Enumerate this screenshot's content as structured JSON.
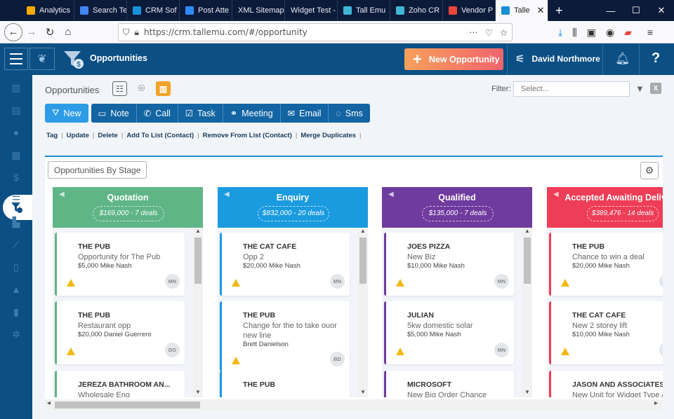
{
  "browser": {
    "tabs": [
      {
        "label": "Analytics",
        "color": "#f9ab00"
      },
      {
        "label": "Search Te",
        "color": "#4285f4"
      },
      {
        "label": "CRM Sof",
        "color": "#1a8fd8"
      },
      {
        "label": "Post Atte",
        "color": "#2d8cff"
      },
      {
        "label": "XML Sitemap",
        "color": ""
      },
      {
        "label": "Widget Test -",
        "color": ""
      },
      {
        "label": "Tall Emu",
        "color": "#3fb6d4"
      },
      {
        "label": "Zoho CR",
        "color": "#3fb6d4"
      },
      {
        "label": "Vendor P",
        "color": "#e8453c"
      },
      {
        "label": "Talle",
        "color": "#1a8fd8",
        "active": true
      }
    ],
    "new_tab": "+",
    "close_tab": "✕",
    "window_controls": [
      "—",
      "☐",
      "✕"
    ],
    "url": "https://crm.tallemu.com/#/opportunity",
    "url_actions": [
      "···",
      "pocket-icon",
      "star-icon"
    ]
  },
  "header": {
    "page_title": "Opportunities",
    "new_opportunity": "New Opportunity",
    "user_name": "David Northmore",
    "help": "?"
  },
  "content": {
    "breadcrumb": "Opportunities",
    "filter_label": "Filter:",
    "filter_placeholder": "Select...",
    "actions": [
      {
        "label": "New",
        "icon": "funnel-icon"
      },
      {
        "label": "Note",
        "icon": "note-icon"
      },
      {
        "label": "Call",
        "icon": "phone-icon"
      },
      {
        "label": "Task",
        "icon": "task-icon"
      },
      {
        "label": "Meeting",
        "icon": "meeting-icon"
      },
      {
        "label": "Email",
        "icon": "email-icon"
      },
      {
        "label": "Sms",
        "icon": "sms-icon"
      }
    ],
    "links": [
      "Tag",
      "Update",
      "Delete",
      "Add To List (Contact)",
      "Remove From List (Contact)",
      "Merge Duplicates"
    ],
    "stage_view_label": "Opportunities By Stage"
  },
  "board": {
    "columns": [
      {
        "name": "Quotation",
        "summary": "$169,000 - 7 deals",
        "color": "#5fb586",
        "cards": [
          {
            "company": "THE PUB",
            "title": "Opportunity for The Pub",
            "meta": "$5,000   Mike Nash",
            "initials": "MN"
          },
          {
            "company": "THE PUB",
            "title": "Restaurant opp",
            "meta": "$20,000   Daniel Guerrero",
            "initials": "DG"
          },
          {
            "company": "JEREZA BATHROOM AN...",
            "title": "Wholesale Enq",
            "meta": "",
            "initials": ""
          }
        ]
      },
      {
        "name": "Enquiry",
        "summary": "$832,000 - 20 deals",
        "color": "#1a9be0",
        "cards": [
          {
            "company": "THE CAT CAFE",
            "title": "Opp 2",
            "meta": "$20,000   Mike Nash",
            "initials": "MN"
          },
          {
            "company": "THE PUB",
            "title": "Change for the to take ouor new line",
            "meta": "Brett Danielson",
            "initials": "BD"
          },
          {
            "company": "THE PUB",
            "title": "",
            "meta": "",
            "initials": ""
          }
        ]
      },
      {
        "name": "Qualified",
        "summary": "$135,000 - 7 deals",
        "color": "#6f3b9e",
        "cards": [
          {
            "company": "JOES PIZZA",
            "title": "New Biz",
            "meta": "$10,000   Mike Nash",
            "initials": "MN"
          },
          {
            "company": "JULIAN",
            "title": "5kw domestic solar",
            "meta": "$5,000   Mike Nash",
            "initials": "MN"
          },
          {
            "company": "MICROSOFT",
            "title": "New Big Order Chance",
            "meta": "",
            "initials": ""
          }
        ]
      },
      {
        "name": "Accepted Awaiting Delivery",
        "summary": "$389,476 - 14 deals",
        "color": "#ee3d56",
        "cards": [
          {
            "company": "THE PUB",
            "title": "Chance to win a deal",
            "meta": "$20,000   Mike Nash",
            "initials": "MN"
          },
          {
            "company": "THE CAT CAFE",
            "title": "New 2 storey lift",
            "meta": "$10,000   Mike Nash",
            "initials": "MN"
          },
          {
            "company": "JASON AND ASSOCIATES",
            "title": "New Unit for Widget Type A",
            "meta": "",
            "initials": ""
          }
        ]
      }
    ]
  }
}
